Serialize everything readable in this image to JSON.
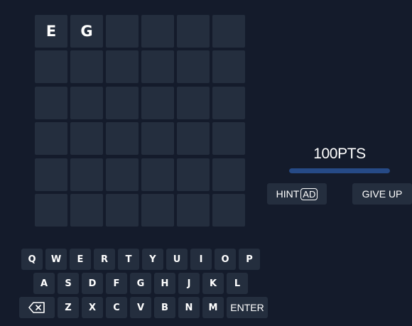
{
  "board": {
    "rows": [
      [
        "E",
        "G",
        "",
        "",
        "",
        ""
      ],
      [
        "",
        "",
        "",
        "",
        "",
        ""
      ],
      [
        "",
        "",
        "",
        "",
        "",
        ""
      ],
      [
        "",
        "",
        "",
        "",
        "",
        ""
      ],
      [
        "",
        "",
        "",
        "",
        "",
        ""
      ],
      [
        "",
        "",
        "",
        "",
        "",
        ""
      ]
    ]
  },
  "score": {
    "label": "100PTS",
    "bar_fraction": 1.0
  },
  "actions": {
    "hint_label": "HINT",
    "ad_badge": "AD",
    "give_up_label": "GIVE UP"
  },
  "keyboard": {
    "row1": [
      "Q",
      "W",
      "E",
      "R",
      "T",
      "Y",
      "U",
      "I",
      "O",
      "P"
    ],
    "row2": [
      "A",
      "S",
      "D",
      "F",
      "G",
      "H",
      "J",
      "K",
      "L"
    ],
    "row3": [
      "Z",
      "X",
      "C",
      "V",
      "B",
      "N",
      "M"
    ],
    "backspace_icon": "backspace-icon",
    "enter_label": "ENTER"
  },
  "colors": {
    "background": "#141b2b",
    "tile": "#242e3e",
    "text": "#ffffff",
    "score_bar": "#264a86"
  }
}
